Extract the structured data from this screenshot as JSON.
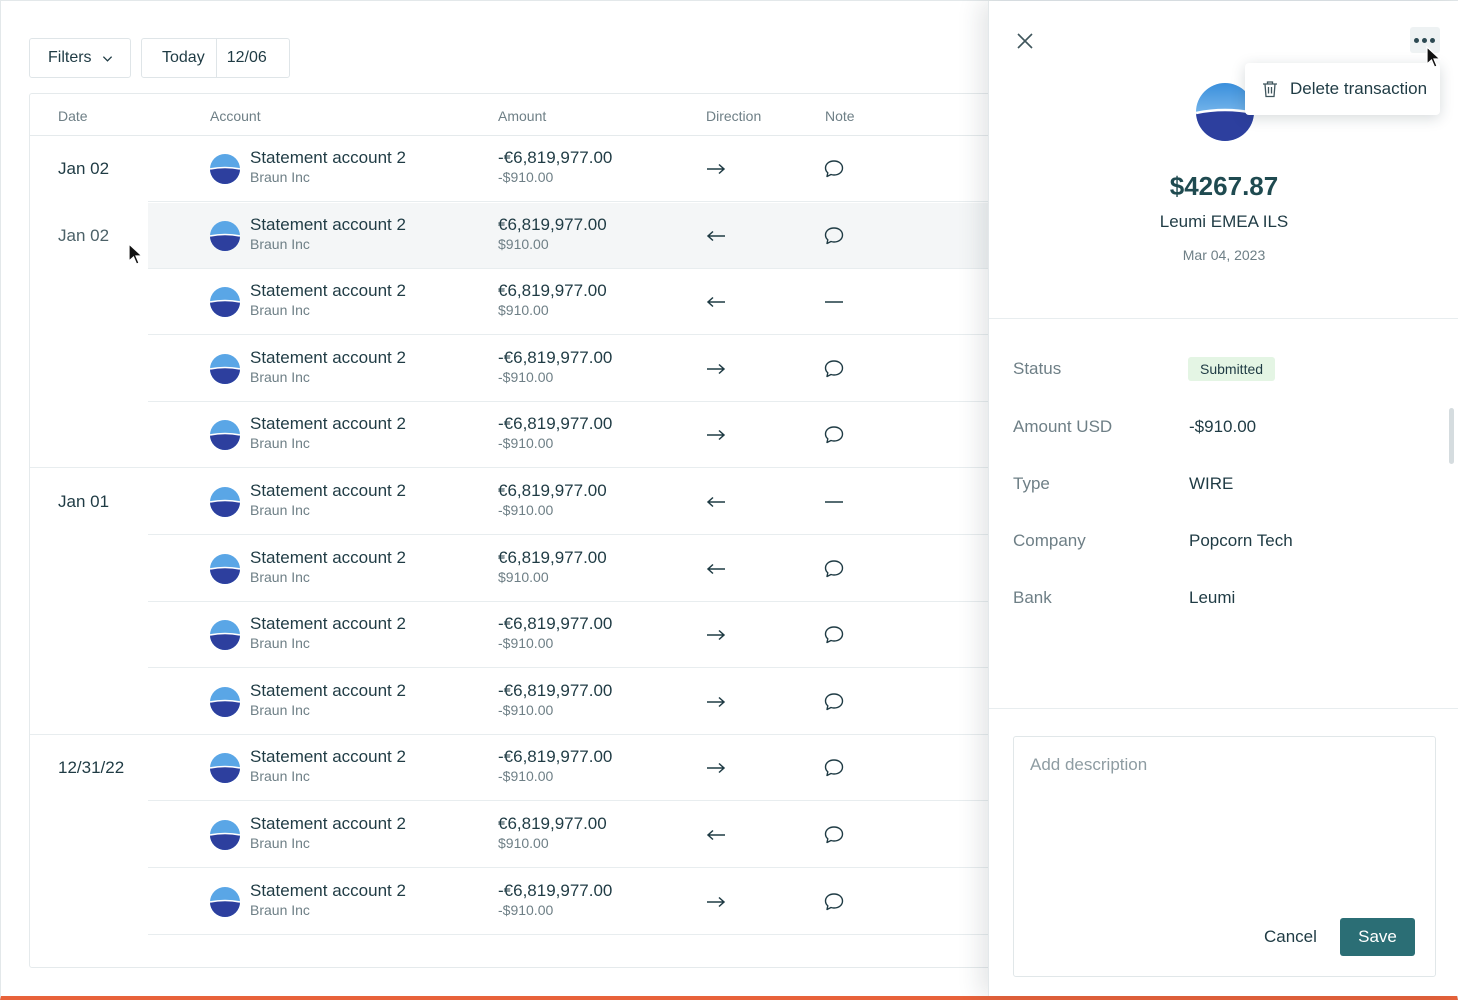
{
  "toolbar": {
    "filters_label": "Filters",
    "today_label": "Today",
    "date_value": "12/06"
  },
  "table": {
    "headers": {
      "date": "Date",
      "account": "Account",
      "amount": "Amount",
      "direction": "Direction",
      "note": "Note"
    },
    "rows": [
      {
        "date": "Jan 02",
        "account": "Statement account 2",
        "company": "Braun Inc",
        "amount": "-€6,819,977.00",
        "amount_usd": "-$910.00",
        "direction": "out",
        "note": "comment-icon"
      },
      {
        "date": "Jan 02",
        "account": "Statement account 2",
        "company": "Braun Inc",
        "amount": "€6,819,977.00",
        "amount_usd": "$910.00",
        "direction": "in",
        "note": "comment-icon",
        "selected": true
      },
      {
        "date": "",
        "account": "Statement account 2",
        "company": "Braun Inc",
        "amount": "€6,819,977.00",
        "amount_usd": "$910.00",
        "direction": "in",
        "note": "dash-icon"
      },
      {
        "date": "",
        "account": "Statement account 2",
        "company": "Braun Inc",
        "amount": "-€6,819,977.00",
        "amount_usd": "-$910.00",
        "direction": "out",
        "note": "comment-icon"
      },
      {
        "date": "",
        "account": "Statement account 2",
        "company": "Braun Inc",
        "amount": "-€6,819,977.00",
        "amount_usd": "-$910.00",
        "direction": "out",
        "note": "comment-icon"
      },
      {
        "date": "Jan 01",
        "account": "Statement account 2",
        "company": "Braun Inc",
        "amount": "€6,819,977.00",
        "amount_usd": "-$910.00",
        "direction": "in",
        "note": "dash-icon"
      },
      {
        "date": "",
        "account": "Statement account 2",
        "company": "Braun Inc",
        "amount": "€6,819,977.00",
        "amount_usd": "$910.00",
        "direction": "in",
        "note": "comment-icon"
      },
      {
        "date": "",
        "account": "Statement account 2",
        "company": "Braun Inc",
        "amount": "-€6,819,977.00",
        "amount_usd": "-$910.00",
        "direction": "out",
        "note": "comment-icon"
      },
      {
        "date": "",
        "account": "Statement account 2",
        "company": "Braun Inc",
        "amount": "-€6,819,977.00",
        "amount_usd": "-$910.00",
        "direction": "out",
        "note": "comment-icon"
      },
      {
        "date": "12/31/22",
        "account": "Statement account 2",
        "company": "Braun Inc",
        "amount": "-€6,819,977.00",
        "amount_usd": "-$910.00",
        "direction": "out",
        "note": "comment-icon"
      },
      {
        "date": "",
        "account": "Statement account 2",
        "company": "Braun Inc",
        "amount": "€6,819,977.00",
        "amount_usd": "$910.00",
        "direction": "in",
        "note": "comment-icon"
      },
      {
        "date": "",
        "account": "Statement account 2",
        "company": "Braun Inc",
        "amount": "-€6,819,977.00",
        "amount_usd": "-$910.00",
        "direction": "out",
        "note": "comment-icon"
      }
    ]
  },
  "panel": {
    "menu_item": "Delete transaction",
    "amount": "$4267.87",
    "account": "Leumi EMEA ILS",
    "date": "Mar 04, 2023",
    "fields": {
      "status_label": "Status",
      "status_value": "Submitted",
      "amount_usd_label": "Amount USD",
      "amount_usd_value": "-$910.00",
      "type_label": "Type",
      "type_value": "WIRE",
      "company_label": "Company",
      "company_value": "Popcorn Tech",
      "bank_label": "Bank",
      "bank_value": "Leumi"
    },
    "description_placeholder": "Add description",
    "cancel_label": "Cancel",
    "save_label": "Save"
  },
  "colors": {
    "accent": "#2b6e75",
    "status_badge_bg": "#e4f5e4",
    "bottom_border": "#e8623a"
  }
}
